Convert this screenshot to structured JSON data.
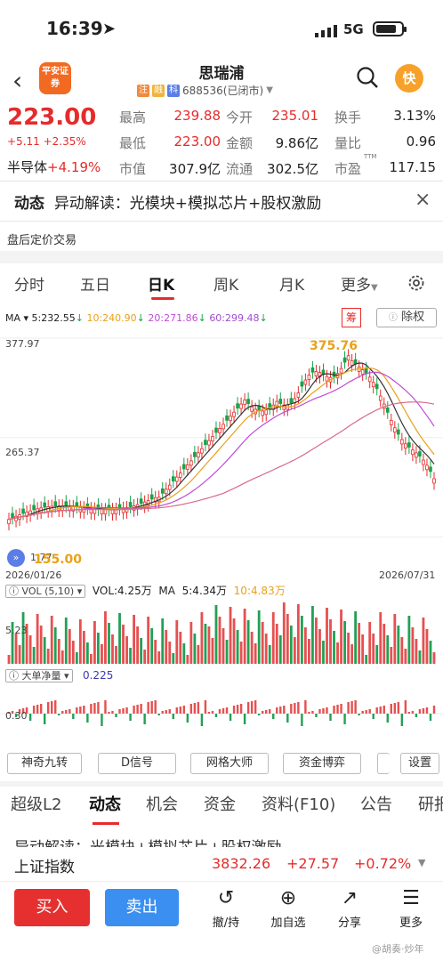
{
  "status": {
    "time": "16:39",
    "network": "5G"
  },
  "header": {
    "app_logo": "平安证券",
    "title": "思瑞浦",
    "tags": [
      "注",
      "融",
      "科"
    ],
    "code": "688536(已闭市)",
    "quick_label": "快"
  },
  "quote": {
    "price": "223.00",
    "change": "+5.11",
    "change_pct": "+2.35%",
    "sector_name": "半导体",
    "sector_pct": "+4.19%",
    "rows": [
      [
        {
          "k": "最高",
          "v": "239.88",
          "c": "red"
        },
        {
          "k": "今开",
          "v": "235.01",
          "c": "red"
        },
        {
          "k": "换手",
          "v": "3.13%",
          "c": "dark"
        }
      ],
      [
        {
          "k": "最低",
          "v": "223.00",
          "c": "red"
        },
        {
          "k": "金额",
          "v": "9.86亿",
          "c": "dark"
        },
        {
          "k": "量比",
          "v": "0.96",
          "c": "dark"
        }
      ],
      [
        {
          "k": "市值",
          "v": "307.9亿",
          "c": "dark"
        },
        {
          "k": "流通",
          "v": "302.5亿",
          "c": "dark"
        },
        {
          "k": "市盈",
          "v": "117.15",
          "c": "dark"
        }
      ]
    ],
    "pe_sup": "TTM"
  },
  "news": {
    "label": "动态",
    "text": "异动解读：光模块+模拟芯片+股权激励"
  },
  "after_hours": "盘后定价交易",
  "period_tabs": [
    "分时",
    "五日",
    "日K",
    "周K",
    "月K",
    "更多"
  ],
  "ma_line": [
    {
      "t": "MA ▾",
      "c": "#222"
    },
    {
      "t": "5:232.55",
      "c": "#222"
    },
    {
      "t": "10:240.90",
      "c": "#e8a11a"
    },
    {
      "t": "20:271.86",
      "c": "#c04ad8"
    },
    {
      "t": "60:299.48",
      "c": "#a04bd0"
    }
  ],
  "chou_label": "筹",
  "fq_label": "除权",
  "kchart": {
    "y_max": "377.97",
    "y_mid": "265.37",
    "y_min": "1.77",
    "low_label": "155.00",
    "high_label": "375.76",
    "date_start": "2026/01/26",
    "date_end": "2026/07/31"
  },
  "vol": {
    "title": "VOL (5,10)",
    "vol": "VOL:4.25万",
    "ma_label": "MA",
    "ma5": "5:4.34万",
    "ma10": "10:4.83万",
    "left_label": "5.23"
  },
  "netflow": {
    "title": "大单净量",
    "value": "0.225",
    "left_label": "0.30"
  },
  "tools": [
    "神奇九转",
    "D信号",
    "网格大师",
    "资金博弈",
    "设置"
  ],
  "bottom_tabs": [
    "超级L2",
    "动态",
    "机会",
    "资金",
    "资料(F10)",
    "公告",
    "研报"
  ],
  "index": {
    "name": "上证指数",
    "value": "3832.26",
    "change": "+27.57",
    "pct": "+0.72%"
  },
  "actions": {
    "buy": "买入",
    "sell": "卖出",
    "items": [
      {
        "icon": "↺",
        "label": "撤/持"
      },
      {
        "icon": "⊕",
        "label": "加自选"
      },
      {
        "icon": "↗",
        "label": "分享"
      },
      {
        "icon": "☰",
        "label": "更多"
      }
    ]
  },
  "watermark": "@胡奏·炒年"
}
